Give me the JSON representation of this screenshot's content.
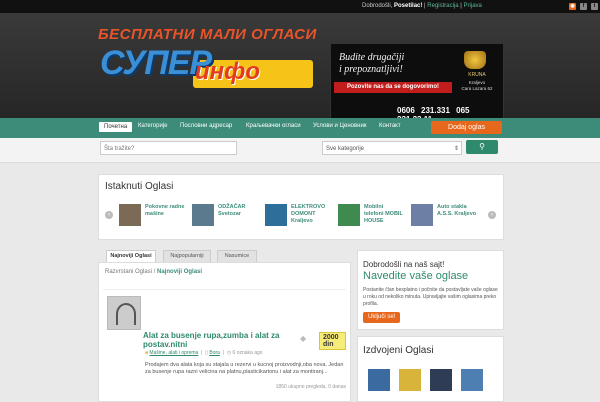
{
  "topbar": {
    "welcome_prefix": "Dobrodošli, ",
    "welcome_name": "Posetilac!",
    "register": "Registracija",
    "login": "Prijava"
  },
  "header": {
    "logo_tagline": "БЕСПЛАТНИ МАЛИ ОГЛАСИ",
    "logo_main": "СУПЕР",
    "logo_sub": "инфо",
    "banner": {
      "slogan_line1": "Budite drugačiji",
      "slogan_line2": "i prepoznatljivi!",
      "cta": "Pozovite nas da se dogovorimo!",
      "brand": "KRUNA",
      "address_line1": "Kraljevo",
      "address_line2": "Cara Lazara 62",
      "phones": "0606 231.331  065 231.33.11"
    }
  },
  "nav": {
    "items": [
      "Почетна",
      "Категорије",
      "Пословни адресар",
      "Краљевачки огласи",
      "Услови и Ценовник",
      "Контакт"
    ],
    "add_button": "Dodaj oglas"
  },
  "search": {
    "placeholder": "Šta tražite?",
    "category_selected": "Sve kategorije"
  },
  "featured": {
    "title": "Istaknuti Oglasi",
    "items": [
      {
        "title": "Pokovne radne mašine"
      },
      {
        "title": "ODŽAČAR Svetozar"
      },
      {
        "title": "ELEKTROVO DOMONT Kraljevo"
      },
      {
        "title": "Mobilni telefoni MOBIL HOUSE"
      },
      {
        "title": "Auto stakla A.S.S. Kraljevo"
      }
    ]
  },
  "tabs": [
    "Najnoviji Oglasi",
    "Najpopularniji",
    "Nasumice"
  ],
  "breadcrumb": {
    "root": "Razvrstani Oglasi",
    "sep": " / ",
    "current": "Najnoviji Oglasi"
  },
  "listing": {
    "title": "Alat za busenje rupa,zumba i alat za postav.nitni",
    "price": "2000 din",
    "category": "Mašine, alati i oprema",
    "author": "Bora",
    "time": "6 oznaka ago",
    "description": "Prodajem dva alata koja su stajala u rezervi u kucnoj proizvodnji,oba nova. Jedan za busenje rupa razni velicina na platnu,plasticikartonu i alat za montiranj...",
    "stats": "1850 ukupno pregleda, 0 danas"
  },
  "sidebar": {
    "welcome_small": "Dobrodošli na naš sajt!",
    "welcome_big": "Navedite vaše oglase",
    "text": "Postanite član besplatno i počnite da postavljate vaše oglase u roku od nekoliko minuta. Upravljajte vašim oglasima preko profila.",
    "signup": "Uključi se!",
    "featured_title": "Izdvojeni Oglasi"
  }
}
